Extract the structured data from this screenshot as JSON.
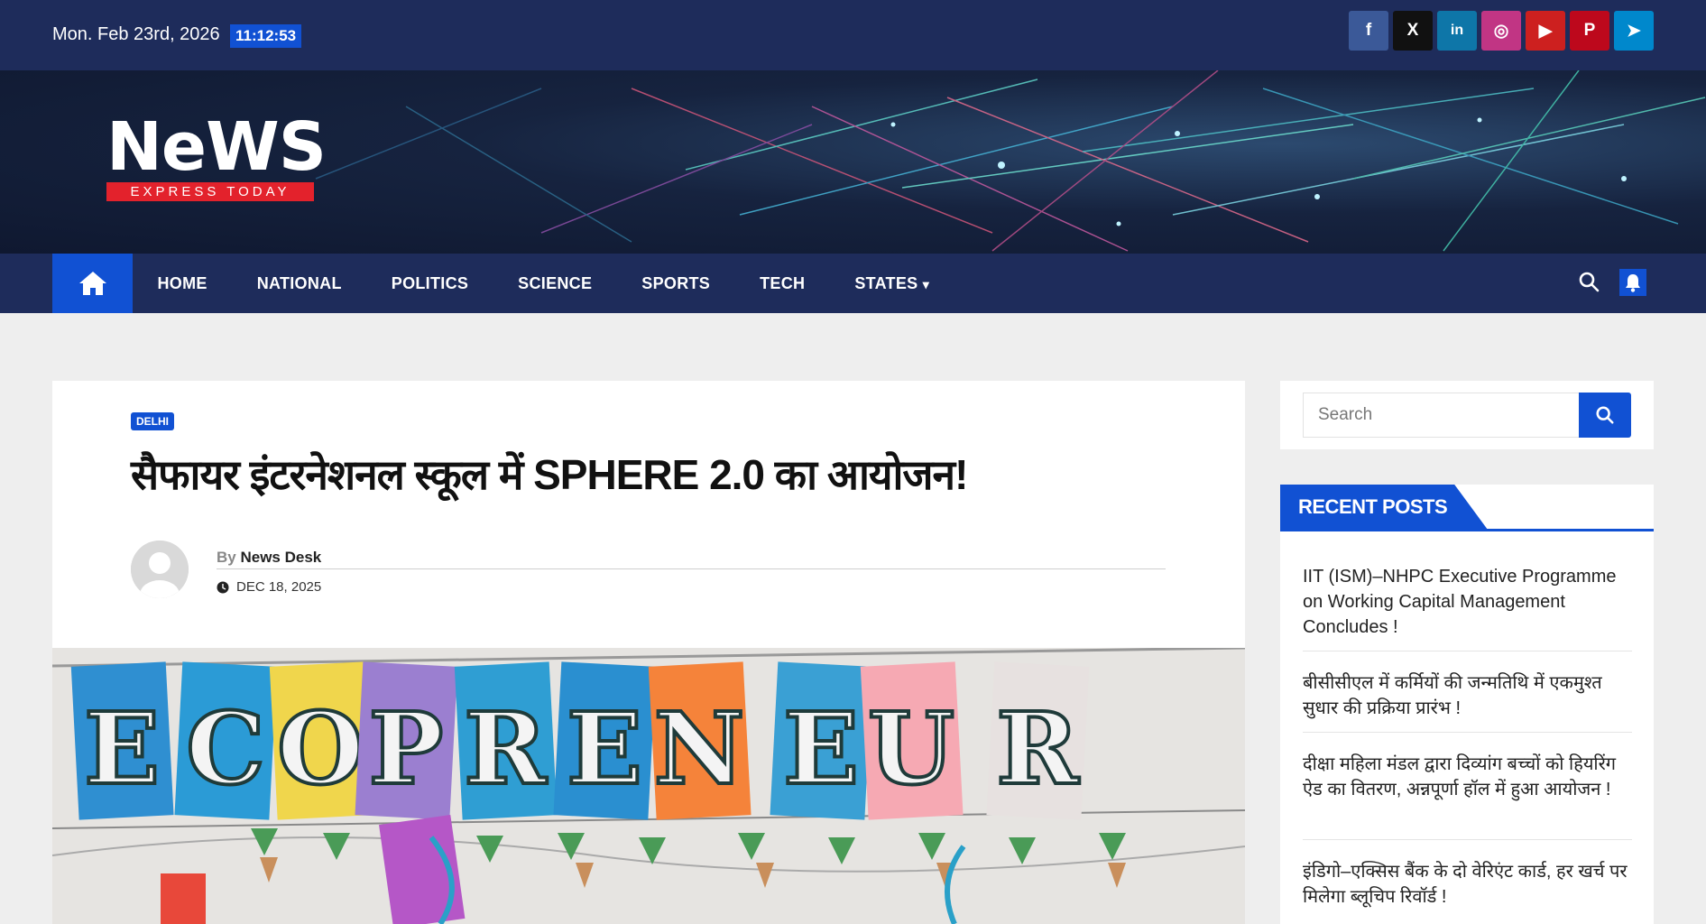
{
  "topbar": {
    "date": "Mon. Feb 23rd, 2026",
    "time": "11:12:53",
    "socials": [
      {
        "name": "facebook-icon",
        "glyph": "f",
        "color": "#3b5998"
      },
      {
        "name": "x-icon",
        "glyph": "X",
        "color": "#111111"
      },
      {
        "name": "linkedin-icon",
        "glyph": "in",
        "color": "#0e76a8"
      },
      {
        "name": "instagram-icon",
        "glyph": "◎",
        "color": "#c13584"
      },
      {
        "name": "youtube-icon",
        "glyph": "▶",
        "color": "#cd201f"
      },
      {
        "name": "pinterest-icon",
        "glyph": "P",
        "color": "#bd081c"
      },
      {
        "name": "telegram-icon",
        "glyph": "➤",
        "color": "#0088cc"
      }
    ]
  },
  "logo": {
    "word": "NeWS",
    "tagline": "EXPRESS TODAY"
  },
  "nav": {
    "items": [
      "HOME",
      "NATIONAL",
      "POLITICS",
      "SCIENCE",
      "SPORTS",
      "TECH",
      "STATES"
    ],
    "states_caret": "▾"
  },
  "article": {
    "category": "DELHI",
    "title": "सैफायर इंटरनेशनल स्कूल में SPHERE 2.0 का आयोजन!",
    "by": "By",
    "author": "News Desk",
    "date": "DEC 18, 2025",
    "banner_letters": [
      "E",
      "C",
      "O",
      "P",
      "R",
      "E",
      "N",
      "E",
      "U",
      "R"
    ]
  },
  "sidebar": {
    "search_placeholder": "Search",
    "recent_title": "RECENT POSTS",
    "recent_posts": [
      "IIT (ISM)–NHPC Executive Programme on Working Capital Management Concludes !",
      "बीसीसीएल में कर्मियों की जन्मतिथि में  एकमुश्त सुधार की प्रक्रिया प्रारंभ !",
      "दीक्षा महिला मंडल द्वारा दिव्यांग बच्चों को हियरिंग ऐड का वितरण, अन्नपूर्णा हॉल में हुआ आयोजन !",
      "इंडिगो–एक्सिस बैंक के दो वेरिएंट कार्ड, हर खर्च पर मिलेगा ब्लूचिप रिवॉर्ड !"
    ]
  },
  "colors": {
    "navy": "#1e2c5b",
    "accent": "#1151d3",
    "logo_red": "#e3222c"
  }
}
